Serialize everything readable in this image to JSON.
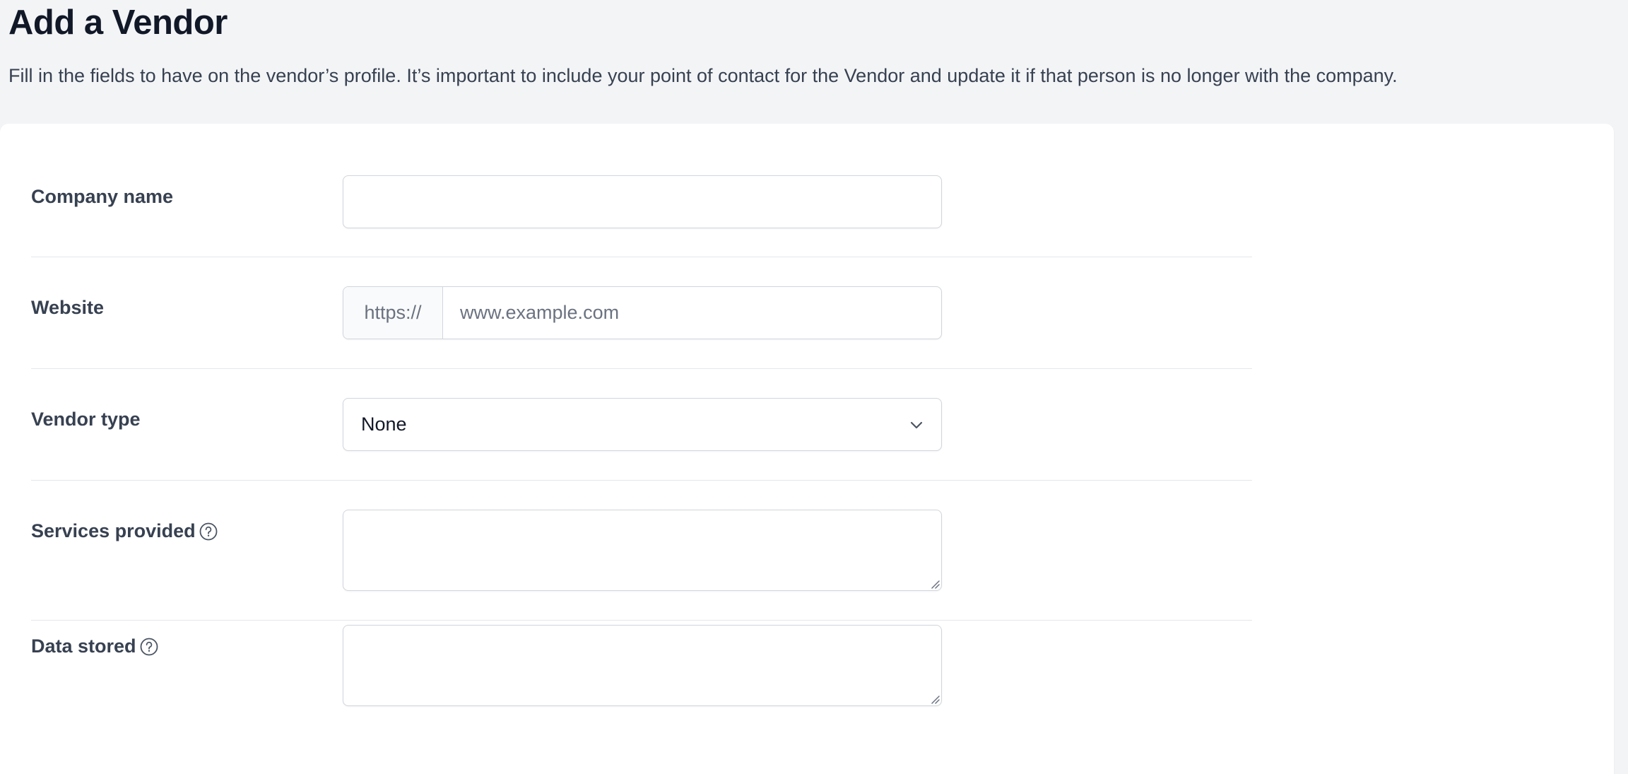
{
  "header": {
    "title": "Add a Vendor",
    "description": "Fill in the fields to have on the vendor’s profile. It’s important to include your point of contact for the Vendor and update it if that person is no longer with the company."
  },
  "form": {
    "company_name": {
      "label": "Company name",
      "value": ""
    },
    "website": {
      "label": "Website",
      "prefix": "https://",
      "placeholder": "www.example.com"
    },
    "vendor_type": {
      "label": "Vendor type",
      "selected": "None"
    },
    "services_provided": {
      "label": "Services provided",
      "value": ""
    },
    "data_stored": {
      "label": "Data stored",
      "value": ""
    }
  },
  "icons": {
    "help": "question-circle-icon",
    "select_arrow": "chevron-down-icon"
  },
  "colors": {
    "page_bg": "#f3f4f6",
    "card_bg": "#ffffff",
    "border": "#d1d5db",
    "label_text": "#374151"
  }
}
